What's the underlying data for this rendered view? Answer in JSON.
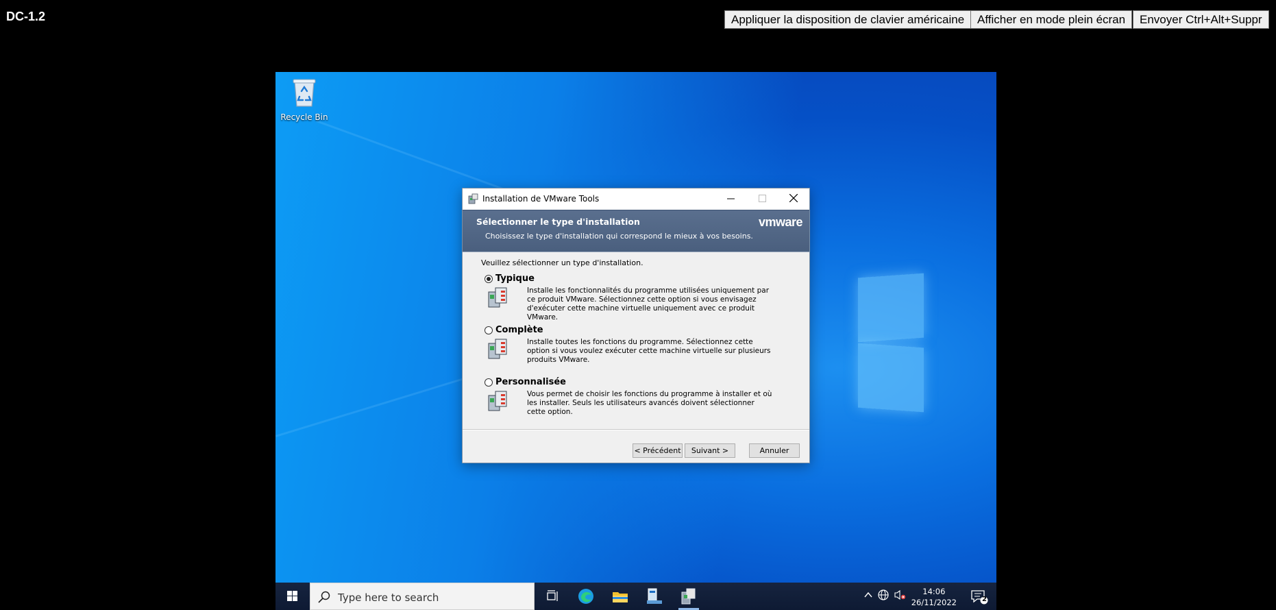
{
  "console": {
    "vm_name": "DC-1.2",
    "buttons": {
      "keyboard": "Appliquer la disposition de clavier américaine",
      "fullscreen": "Afficher en mode plein écran",
      "ctrl_alt_del": "Envoyer Ctrl+Alt+Suppr"
    }
  },
  "desktop": {
    "recycle_bin_label": "Recycle Bin"
  },
  "dialog": {
    "title": "Installation de VMware Tools",
    "header_title": "Sélectionner le type d'installation",
    "header_subtitle": "Choisissez le type d'installation qui correspond le mieux à vos besoins.",
    "logo": "vmware",
    "prompt": "Veuillez sélectionner un type d'installation.",
    "options": [
      {
        "name": "Typique",
        "selected": true,
        "description": "Installe les fonctionnalités du programme utilisées uniquement par ce produit VMware. Sélectionnez cette option si vous envisagez d'exécuter cette machine virtuelle uniquement avec ce produit VMware."
      },
      {
        "name": "Complète",
        "selected": false,
        "description": "Installe toutes les fonctions du programme. Sélectionnez cette option si vous voulez exécuter cette machine virtuelle sur plusieurs produits VMware."
      },
      {
        "name": "Personnalisée",
        "selected": false,
        "description": "Vous permet de choisir les fonctions du programme à installer et où les installer. Seuls les utilisateurs avancés doivent sélectionner cette option."
      }
    ],
    "buttons": {
      "back": "< Précédent",
      "next": "Suivant >",
      "cancel": "Annuler"
    }
  },
  "taskbar": {
    "search_placeholder": "Type here to search",
    "time": "14:06",
    "date": "26/11/2022",
    "notification_count": "2"
  }
}
